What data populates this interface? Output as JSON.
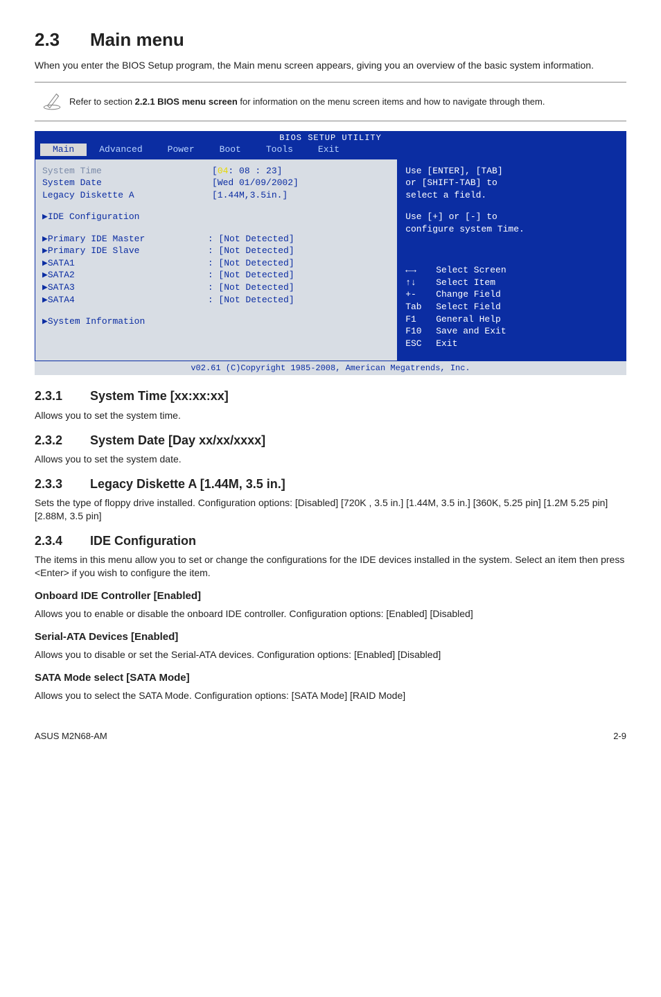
{
  "section": {
    "num": "2.3",
    "title": "Main menu"
  },
  "intro": "When you enter the BIOS Setup program, the Main menu screen appears, giving you an overview of the basic system information.",
  "note": {
    "text_a": "Refer to section ",
    "bold": "2.2.1 BIOS menu screen",
    "text_b": " for information on the menu screen items and how to navigate through them."
  },
  "bios": {
    "title": "BIOS SETUP UTILITY",
    "menu": [
      "Main",
      "Advanced",
      "Power",
      "Boot",
      "Tools",
      "Exit"
    ],
    "left": {
      "sys_time_label": "System Time",
      "sys_time_val_prefix": "[",
      "sys_time_hh": "04",
      "sys_time_rest": ": 08 : 23]",
      "sys_date_label": "System Date",
      "sys_date_val": "[Wed 01/09/2002]",
      "legacy_label": "Legacy Diskette A",
      "legacy_val": "[1.44M,3.5in.]",
      "ide_conf": "IDE Configuration",
      "rows": [
        {
          "label": "Primary IDE Master",
          "val": ": [Not Detected]"
        },
        {
          "label": "Primary IDE Slave",
          "val": ": [Not Detected]"
        },
        {
          "label": "SATA1",
          "val": ": [Not Detected]"
        },
        {
          "label": "SATA2",
          "val": ": [Not Detected]"
        },
        {
          "label": "SATA3",
          "val": ": [Not Detected]"
        },
        {
          "label": "SATA4",
          "val": ": [Not Detected]"
        }
      ],
      "sys_info": "System Information"
    },
    "right": {
      "line1": "Use [ENTER], [TAB]",
      "line2": "or [SHIFT-TAB] to",
      "line3": "select a field.",
      "line4": "Use [+] or [-] to",
      "line5": "configure system Time.",
      "keys": [
        {
          "icon": "lr",
          "desc": "Select Screen"
        },
        {
          "icon": "ud",
          "desc": "Select Item"
        },
        {
          "key": "+-",
          "desc": "Change Field"
        },
        {
          "key": "Tab",
          "desc": "Select Field"
        },
        {
          "key": "F1",
          "desc": "General Help"
        },
        {
          "key": "F10",
          "desc": "Save and Exit"
        },
        {
          "key": "ESC",
          "desc": "Exit"
        }
      ]
    },
    "footer": "v02.61 (C)Copyright 1985-2008, American Megatrends, Inc."
  },
  "subs": {
    "s231": {
      "num": "2.3.1",
      "title": "System Time [xx:xx:xx]",
      "body": "Allows you to set the system time."
    },
    "s232": {
      "num": "2.3.2",
      "title": "System Date [Day xx/xx/xxxx]",
      "body": "Allows you to set the system date."
    },
    "s233": {
      "num": "2.3.3",
      "title": "Legacy Diskette A [1.44M, 3.5 in.]",
      "body": "Sets the type of floppy drive installed. Configuration options: [Disabled] [720K , 3.5 in.] [1.44M, 3.5 in.] [360K, 5.25 pin] [1.2M 5.25 pin] [2.88M, 3.5 pin]"
    },
    "s234": {
      "num": "2.3.4",
      "title": "IDE Configuration",
      "body": "The items in this menu allow you to set or change the configurations for the IDE devices installed in the system. Select an item then press <Enter> if you wish to configure the item."
    },
    "onboard": {
      "title": "Onboard IDE Controller [Enabled]",
      "body": "Allows you to enable or disable the onboard IDE controller. Configuration options: [Enabled] [Disabled]"
    },
    "serial": {
      "title": "Serial-ATA Devices [Enabled]",
      "body": "Allows you to disable or set the Serial-ATA devices. Configuration options: [Enabled] [Disabled]"
    },
    "sata": {
      "title": "SATA Mode select [SATA Mode]",
      "body_a": "Allows you to ",
      "body_b": "select the SATA Mode. Configuration options: [SATA Mode] [RAID Mode]"
    }
  },
  "footer": {
    "left": "ASUS M2N68-AM",
    "right": "2-9"
  }
}
